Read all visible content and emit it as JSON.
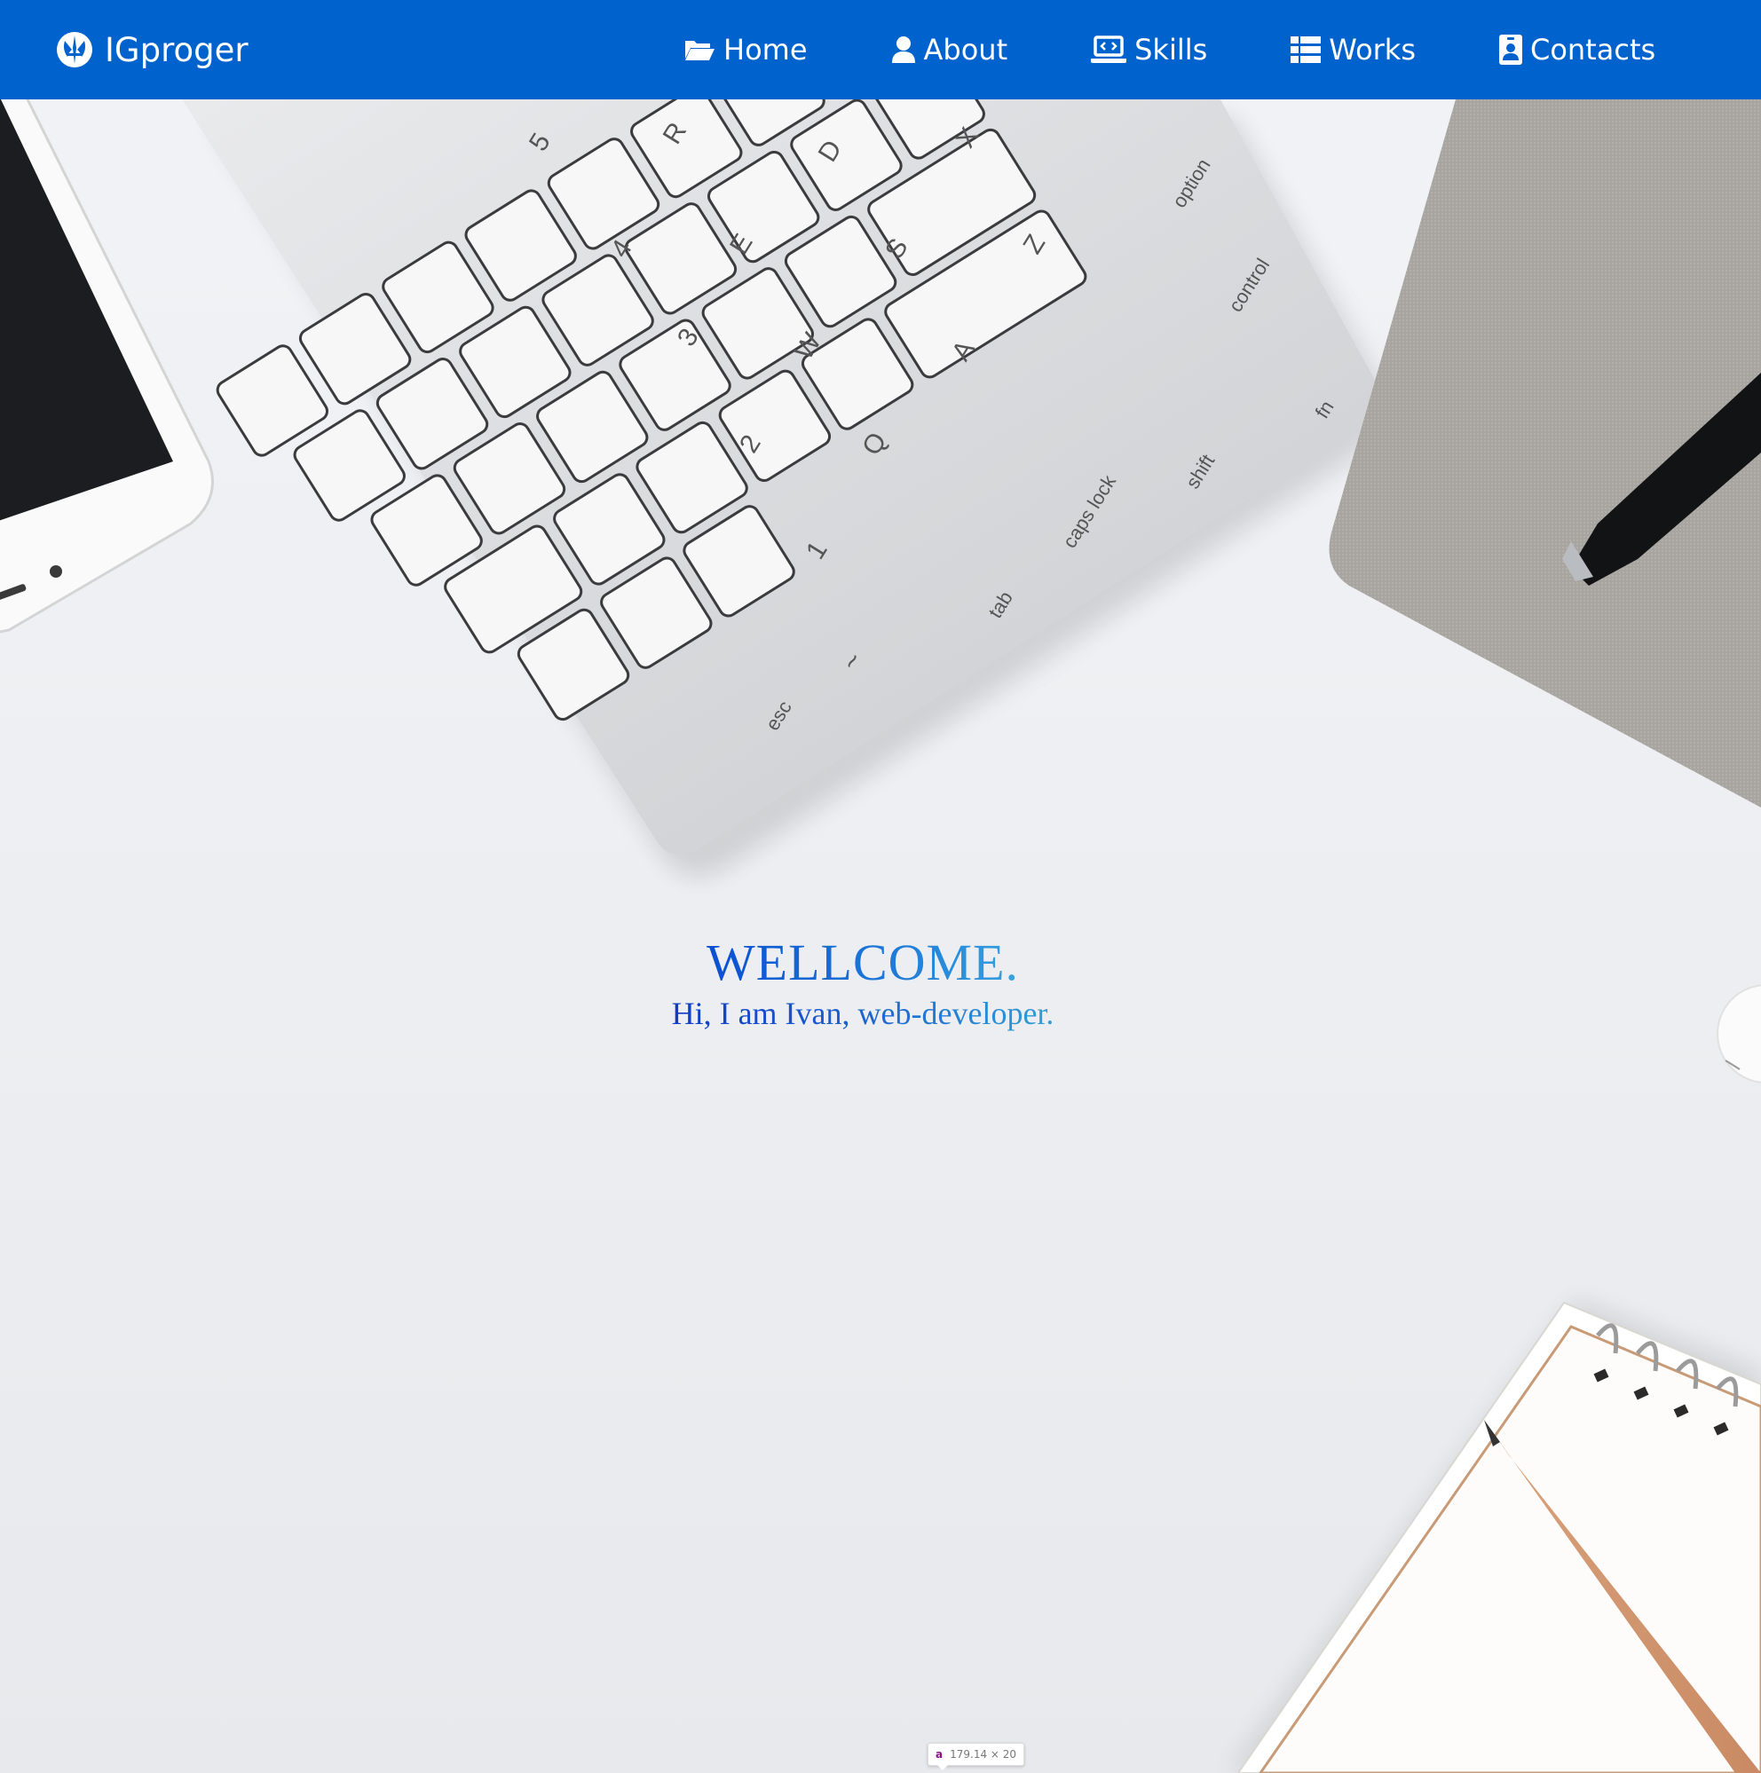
{
  "brand": {
    "name": "IGproger",
    "logo_icon": "jedi-order-icon"
  },
  "nav": {
    "items": [
      {
        "label": "Home",
        "icon": "folder-open-icon"
      },
      {
        "label": "About",
        "icon": "user-icon"
      },
      {
        "label": "Skills",
        "icon": "laptop-code-icon"
      },
      {
        "label": "Works",
        "icon": "th-list-icon"
      },
      {
        "label": "Contacts",
        "icon": "address-card-icon"
      }
    ]
  },
  "hero": {
    "title": "WELLCOME.",
    "subtitle": "Hi, I am Ivan, web-developer."
  },
  "tooltip": {
    "tag": "a",
    "size": "179.14 × 20"
  },
  "colors": {
    "navbar": "#0062cc",
    "title_gradient_start": "#0a4fd1",
    "title_gradient_end": "#35a3e0",
    "background": "#eceef1"
  }
}
